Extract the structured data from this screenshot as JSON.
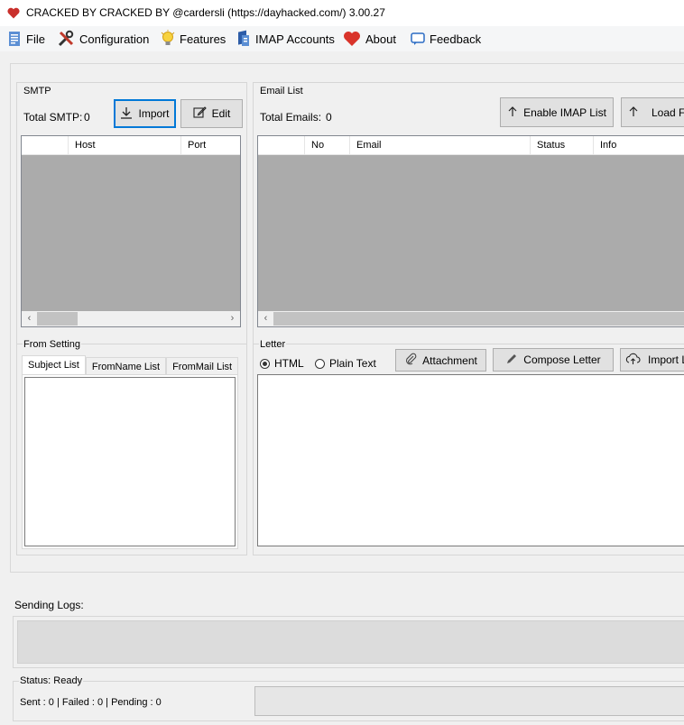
{
  "window": {
    "title": "CRACKED BY CRACKED BY @cardersli (https://dayhacked.com/)  3.00.27",
    "icon": "heart-icon",
    "accent": "#d0342c"
  },
  "menu": [
    {
      "label": "File",
      "icon": "file-icon"
    },
    {
      "label": "Configuration",
      "icon": "tools-icon"
    },
    {
      "label": "Features",
      "icon": "lightbulb-icon"
    },
    {
      "label": "IMAP Accounts",
      "icon": "imap-icon"
    },
    {
      "label": "About",
      "icon": "heart-icon"
    },
    {
      "label": "Feedback",
      "icon": "feedback-icon"
    }
  ],
  "smtp": {
    "title": "SMTP",
    "total_label": "Total SMTP:",
    "total_value": "0",
    "import_label": "Import",
    "edit_label": "Edit",
    "columns": [
      "",
      "Host",
      "Port"
    ]
  },
  "email_list": {
    "title": "Email List",
    "total_label": "Total Emails:",
    "total_value": "0",
    "enable_imap_label": "Enable IMAP List",
    "load_label": "Load Fro",
    "columns": [
      "",
      "No",
      "Email",
      "Status",
      "Info"
    ]
  },
  "from_setting": {
    "title": "From Setting",
    "tabs": [
      "Subject List",
      "FromName List",
      "FromMail List"
    ],
    "active_tab": "Subject List"
  },
  "letter": {
    "title": "Letter",
    "format_options": [
      "HTML",
      "Plain Text"
    ],
    "selected_format": "HTML",
    "attachment_label": "Attachment",
    "compose_label": "Compose Letter",
    "import_label": "Import Let"
  },
  "logs": {
    "label": "Sending Logs:"
  },
  "status": {
    "label": "Status: Ready",
    "counts": "Sent : 0 | Failed : 0 | Pending : 0"
  }
}
